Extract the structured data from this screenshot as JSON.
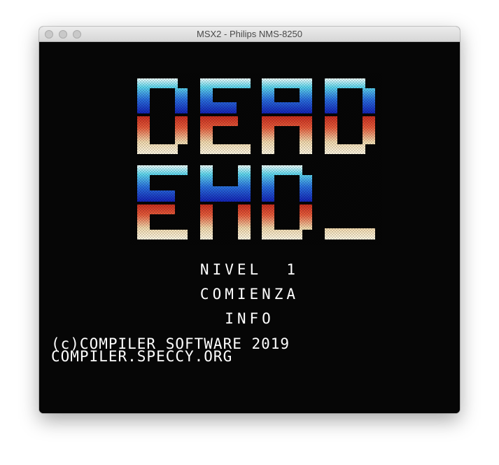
{
  "window": {
    "title": "MSX2 - Philips NMS-8250",
    "controls": [
      "close-button",
      "minimize-button",
      "zoom-button"
    ]
  },
  "game": {
    "logo_text": [
      "DEAD",
      "END_"
    ],
    "menu": [
      {
        "label": "NIVEL  1"
      },
      {
        "label": "COMIENZA"
      },
      {
        "label": "INFO"
      }
    ],
    "credits": {
      "copyright": "(c)COMPILER SOFTWARE 2019",
      "website": "COMPILER.SPECCY.ORG"
    }
  },
  "colors": {
    "background": "#060606",
    "text": "#ffffff",
    "logo_top": [
      "#f0ffff",
      "#5ed8f0",
      "#2a70e0",
      "#1424b8"
    ],
    "logo_bottom": [
      "#c42418",
      "#e85c3c",
      "#f4dcb0",
      "#fff8e4"
    ]
  }
}
